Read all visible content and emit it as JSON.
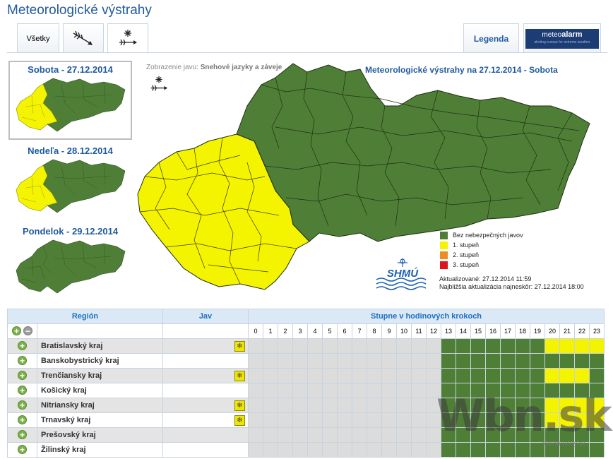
{
  "page": {
    "title": "Meteorologické výstrahy"
  },
  "tabs": {
    "all_label": "Všetky",
    "wind_icon": "wind-icon",
    "snow_icon": "snow-drift-icon",
    "legend_label": "Legenda",
    "meteoalarm": {
      "brand_prefix": "meteo",
      "brand_suffix": "alarm",
      "tagline": "alerting europe for extreme weather"
    }
  },
  "days": [
    {
      "title": "Sobota - 27.12.2014",
      "selected": true
    },
    {
      "title": "Nedeľa - 28.12.2014",
      "selected": false
    },
    {
      "title": "Pondelok - 29.12.2014",
      "selected": false
    }
  ],
  "display": {
    "label": "Zobrazenie javu:",
    "value": "Snehové jazyky a záveje"
  },
  "map": {
    "title": "Meteorologické výstrahy na 27.12.2014 - Sobota"
  },
  "legend": [
    {
      "label": "Bez nebezpečných javov",
      "color": "#4f7f36"
    },
    {
      "label": "1. stupeň",
      "color": "#f4f300"
    },
    {
      "label": "2. stupeň",
      "color": "#f08a24"
    },
    {
      "label": "3. stupeň",
      "color": "#e0141c"
    }
  ],
  "update": {
    "updated": "Aktualizované: 27.12.2014 11:59",
    "next": "Najbližšia aktualizácia najneskôr: 27.12.2014 18:00"
  },
  "logo": {
    "text": "SHMÚ"
  },
  "table": {
    "headers": {
      "region": "Región",
      "jav": "Jav",
      "steps": "Stupne v hodinových krokoch"
    },
    "hours": [
      "0",
      "1",
      "2",
      "3",
      "4",
      "5",
      "6",
      "7",
      "8",
      "9",
      "10",
      "11",
      "12",
      "13",
      "14",
      "15",
      "16",
      "17",
      "18",
      "19",
      "20",
      "21",
      "22",
      "23"
    ],
    "rows": [
      {
        "region": "Bratislavský kraj",
        "jav": true,
        "alt": true,
        "yellow_from": 20,
        "yellow_to": 23
      },
      {
        "region": "Banskobystrický kraj",
        "jav": false,
        "alt": false,
        "yellow_from": -1,
        "yellow_to": -1
      },
      {
        "region": "Trenčiansky kraj",
        "jav": true,
        "alt": true,
        "yellow_from": 20,
        "yellow_to": 22
      },
      {
        "region": "Košický kraj",
        "jav": false,
        "alt": false,
        "yellow_from": -1,
        "yellow_to": -1
      },
      {
        "region": "Nitriansky kraj",
        "jav": true,
        "alt": true,
        "yellow_from": 20,
        "yellow_to": 23
      },
      {
        "region": "Trnavský kraj",
        "jav": true,
        "alt": false,
        "yellow_from": 20,
        "yellow_to": 23
      },
      {
        "region": "Prešovský kraj",
        "jav": false,
        "alt": true,
        "yellow_from": -1,
        "yellow_to": -1
      },
      {
        "region": "Žilinský kraj",
        "jav": false,
        "alt": false,
        "yellow_from": -1,
        "yellow_to": -1
      }
    ],
    "green_from": 13
  },
  "watermark": {
    "main": "Wbn.sk",
    "sub": "Webnoviny.sk"
  },
  "colors": {
    "green": "#4f7f36",
    "yellow": "#f4f300",
    "empty": "#dcdcdc"
  }
}
